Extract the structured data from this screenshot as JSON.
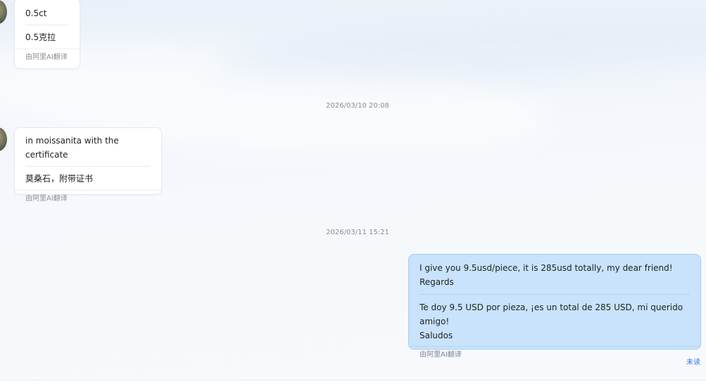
{
  "messages": [
    {
      "direction": "in",
      "original": "0.5ct",
      "translation": "0.5克拉",
      "footer": "由阿里AI翻译"
    },
    {
      "direction": "in",
      "original": "in moissanita with the certificate",
      "translation": "莫桑石，附带证书",
      "footer": "由阿里AI翻译"
    },
    {
      "direction": "out",
      "original": "I give you 9.5usd/piece, it is 285usd totally, my dear friend!\nRegards",
      "translation": "Te doy 9.5 USD por pieza, ¡es un total de 285 USD, mi querido amigo!\nSaludos",
      "footer": "由阿里AI翻译",
      "status": "未读"
    }
  ],
  "timestamps": [
    "2026/03/10 20:08",
    "2026/03/11 15:21"
  ],
  "colors": {
    "outgoing_bubble": "#c8e3fb",
    "incoming_bubble": "#ffffff",
    "unread_status": "#2a7ae2"
  }
}
